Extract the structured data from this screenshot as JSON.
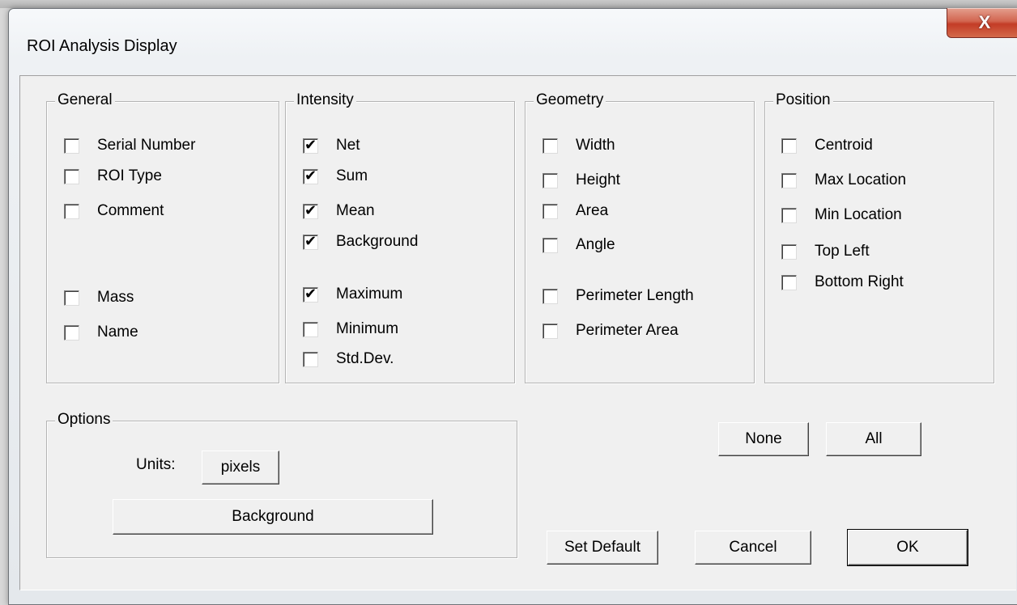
{
  "window": {
    "title": "ROI Analysis Display",
    "close_label": "X"
  },
  "groups": {
    "general": {
      "label": "General",
      "items": [
        {
          "label": "Serial Number",
          "checked": false
        },
        {
          "label": "ROI Type",
          "checked": false
        },
        {
          "label": "Comment",
          "checked": false
        },
        {
          "label": "Mass",
          "checked": false
        },
        {
          "label": "Name",
          "checked": false
        }
      ]
    },
    "intensity": {
      "label": "Intensity",
      "items": [
        {
          "label": "Net",
          "checked": true
        },
        {
          "label": "Sum",
          "checked": true
        },
        {
          "label": "Mean",
          "checked": true
        },
        {
          "label": "Background",
          "checked": true
        },
        {
          "label": "Maximum",
          "checked": true
        },
        {
          "label": "Minimum",
          "checked": false
        },
        {
          "label": "Std.Dev.",
          "checked": false
        }
      ]
    },
    "geometry": {
      "label": "Geometry",
      "items": [
        {
          "label": "Width",
          "checked": false
        },
        {
          "label": "Height",
          "checked": false
        },
        {
          "label": "Area",
          "checked": false
        },
        {
          "label": "Angle",
          "checked": false
        },
        {
          "label": "Perimeter Length",
          "checked": false
        },
        {
          "label": "Perimeter Area",
          "checked": false
        }
      ]
    },
    "position": {
      "label": "Position",
      "items": [
        {
          "label": "Centroid",
          "checked": false
        },
        {
          "label": "Max Location",
          "checked": false
        },
        {
          "label": "Min Location",
          "checked": false
        },
        {
          "label": "Top Left",
          "checked": false
        },
        {
          "label": "Bottom Right",
          "checked": false
        }
      ]
    },
    "options": {
      "label": "Options",
      "units_label": "Units:",
      "units_value": "pixels",
      "background_button": "Background"
    }
  },
  "buttons": {
    "none": "None",
    "all": "All",
    "set_default": "Set Default",
    "cancel": "Cancel",
    "ok": "OK"
  },
  "check_glyph": "✔"
}
